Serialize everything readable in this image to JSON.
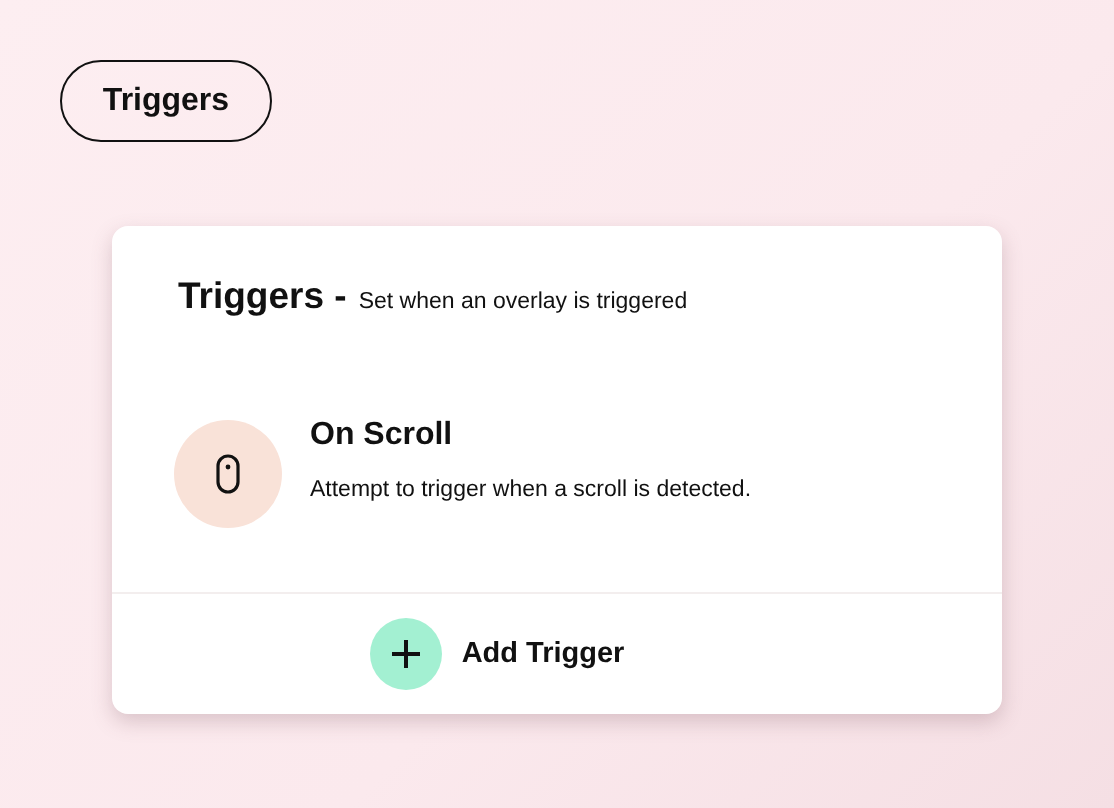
{
  "badge": {
    "label": "Triggers"
  },
  "card": {
    "title": "Triggers -",
    "subtitle": "Set when an overlay is triggered",
    "triggers": [
      {
        "kind": "scroll",
        "name": "On Scroll",
        "description": "Attempt to trigger when a scroll is detected."
      }
    ],
    "add_button": {
      "label": "Add Trigger"
    }
  }
}
